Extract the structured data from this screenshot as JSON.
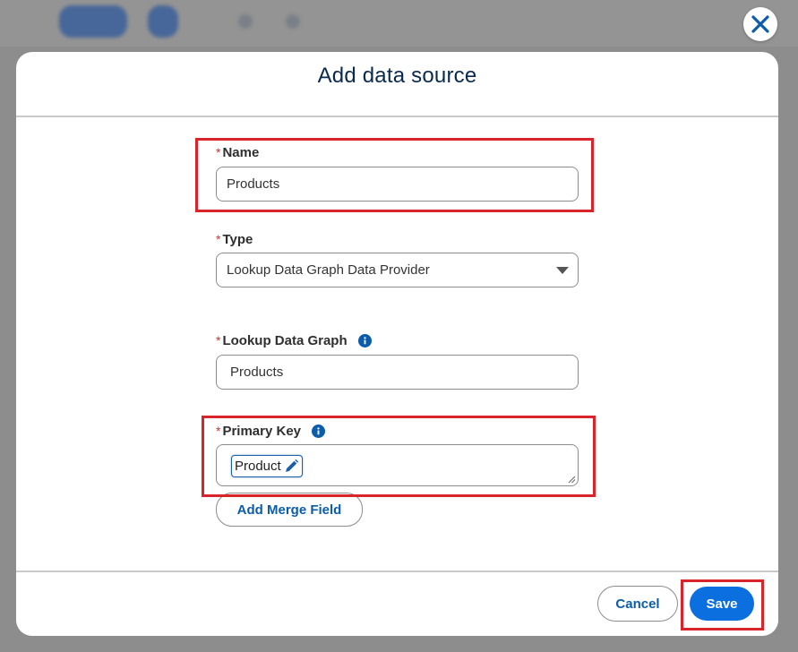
{
  "dialog": {
    "title": "Add data source",
    "close_icon": "close-icon"
  },
  "fields": {
    "name": {
      "required_marker": "*",
      "label": "Name",
      "value": "Products"
    },
    "type": {
      "required_marker": "*",
      "label": "Type",
      "value": "Lookup Data Graph Data Provider"
    },
    "lookup_data_graph": {
      "required_marker": "*",
      "label": "Lookup Data Graph",
      "value": "Products",
      "info_icon": "info-icon"
    },
    "primary_key": {
      "required_marker": "*",
      "label": "Primary Key",
      "token": "Product",
      "info_icon": "info-icon",
      "token_icon": "pencil-icon"
    }
  },
  "buttons": {
    "add_merge_field": "Add Merge Field",
    "cancel": "Cancel",
    "save": "Save"
  },
  "colors": {
    "accent": "#0b6fe0",
    "link": "#0b5cab",
    "title": "#0a2a4d",
    "required": "#c23934",
    "highlight": "#d9242b"
  }
}
